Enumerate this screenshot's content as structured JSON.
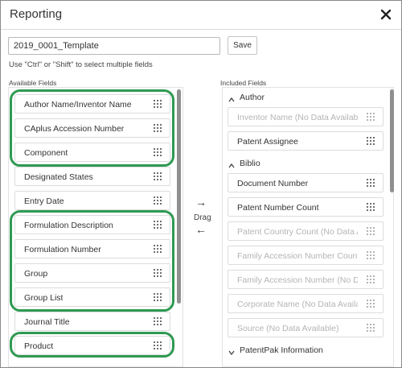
{
  "dialog": {
    "title": "Reporting",
    "close_icon": "close-icon"
  },
  "template": {
    "value": "2019_0001_Template",
    "save_label": "Save"
  },
  "hint": "Use \"Ctrl\" or \"Shift\" to select multiple fields",
  "available": {
    "label": "Available Fields",
    "items": [
      {
        "label": "Author Name/Inventor Name"
      },
      {
        "label": "CAplus Accession Number"
      },
      {
        "label": "Component"
      },
      {
        "label": "Designated States"
      },
      {
        "label": "Entry Date"
      },
      {
        "label": "Formulation Description"
      },
      {
        "label": "Formulation Number"
      },
      {
        "label": "Group"
      },
      {
        "label": "Group List"
      },
      {
        "label": "Journal Title"
      },
      {
        "label": "Product"
      }
    ]
  },
  "transfer": {
    "right_arrow": "→",
    "left_arrow": "←",
    "drag_label": "Drag"
  },
  "included": {
    "label": "Included Fields",
    "sections": [
      {
        "label": "Author"
      },
      {
        "label": "Biblio"
      },
      {
        "label": "PatentPak Information"
      }
    ],
    "items": [
      {
        "label": "Inventor Name (No Data Available)",
        "disabled": true
      },
      {
        "label": "Patent Assignee",
        "disabled": false
      },
      {
        "label": "Document Number",
        "disabled": false
      },
      {
        "label": "Patent Number Count",
        "disabled": false
      },
      {
        "label": "Patent Country Count (No Data Av...",
        "disabled": true
      },
      {
        "label": "Family Accession Number Count (...",
        "disabled": true
      },
      {
        "label": "Family Accession Number (No Data...",
        "disabled": true
      },
      {
        "label": "Corporate Name (No Data Available)",
        "disabled": true
      },
      {
        "label": "Source (No Data Available)",
        "disabled": true
      }
    ]
  },
  "colors": {
    "highlight": "#2e9a52",
    "border": "#dcdcdc",
    "disabled_text": "#b4b4b4"
  }
}
